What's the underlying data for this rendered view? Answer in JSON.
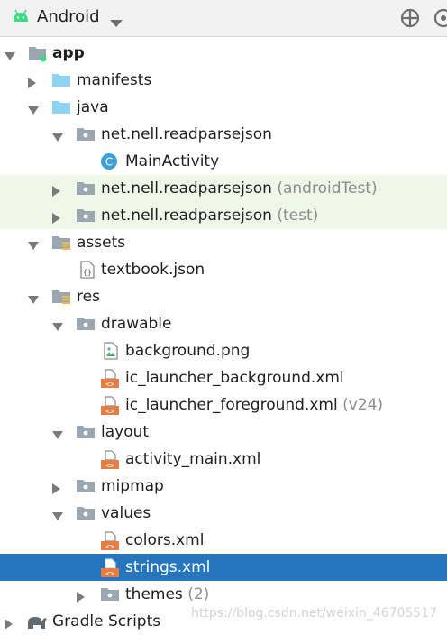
{
  "toolbar": {
    "view_mode": "Android"
  },
  "tree": {
    "app": {
      "label": "app"
    },
    "manifests": {
      "label": "manifests"
    },
    "java": {
      "label": "java"
    },
    "pkg_main": {
      "label": "net.nell.readparsejson"
    },
    "main_activity": {
      "label": "MainActivity"
    },
    "pkg_android_test": {
      "label": "net.nell.readparsejson",
      "suffix": "(androidTest)"
    },
    "pkg_test": {
      "label": "net.nell.readparsejson",
      "suffix": "(test)"
    },
    "assets": {
      "label": "assets"
    },
    "textbook_json": {
      "label": "textbook.json"
    },
    "res": {
      "label": "res"
    },
    "drawable": {
      "label": "drawable"
    },
    "background_png": {
      "label": "background.png"
    },
    "ic_launcher_background": {
      "label": "ic_launcher_background.xml"
    },
    "ic_launcher_foreground": {
      "label": "ic_launcher_foreground.xml",
      "suffix": "(v24)"
    },
    "layout": {
      "label": "layout"
    },
    "activity_main": {
      "label": "activity_main.xml"
    },
    "mipmap": {
      "label": "mipmap"
    },
    "values": {
      "label": "values"
    },
    "colors_xml": {
      "label": "colors.xml"
    },
    "strings_xml": {
      "label": "strings.xml"
    },
    "themes": {
      "label": "themes",
      "suffix": "(2)"
    },
    "gradle_scripts": {
      "label": "Gradle Scripts"
    }
  },
  "watermark": "https://blog.csdn.net/weixin_46705517",
  "colors": {
    "selection": "#2675bf",
    "highlight_row": "#eff7e8",
    "folder_blue": "#8ed3f0",
    "folder_gray": "#9aa7b0",
    "android_green": "#3ddc84",
    "xml_orange": "#e57e44"
  }
}
